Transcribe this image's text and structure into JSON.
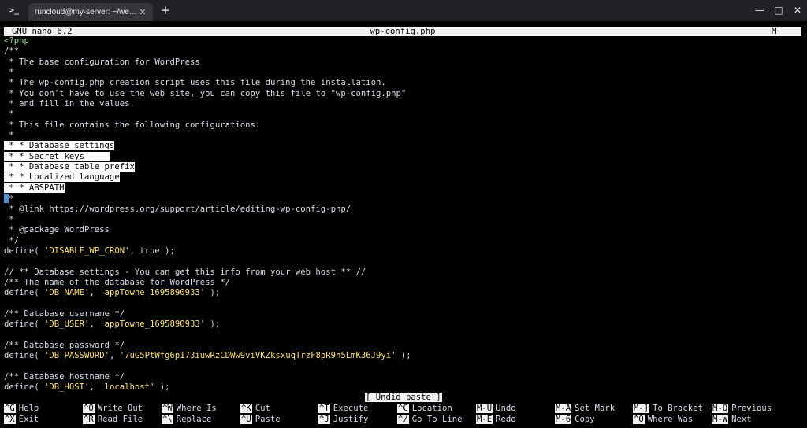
{
  "window": {
    "tab_title": "runcloud@my-server: ~/webapps/a",
    "app_icon": ">_",
    "new_tab": "+",
    "controls": {
      "minimize": "—",
      "maximize": "□",
      "close": "✕"
    }
  },
  "nano": {
    "version": "GNU nano 6.2",
    "filename": "wp-config.php",
    "modified_flag": "M",
    "status_message": "[ Undid paste ]"
  },
  "code": [
    [
      {
        "t": "kw",
        "v": "<?php"
      }
    ],
    [
      {
        "t": "c",
        "v": "/**"
      }
    ],
    [
      {
        "t": "c",
        "v": " * The base configuration for WordPress"
      }
    ],
    [
      {
        "t": "c",
        "v": " *"
      }
    ],
    [
      {
        "t": "c",
        "v": " * The wp-config.php creation script uses this file during the installation."
      }
    ],
    [
      {
        "t": "c",
        "v": " * You don't have to use the web site, you can copy this file to \"wp-config.php\""
      }
    ],
    [
      {
        "t": "c",
        "v": " * and fill in the values."
      }
    ],
    [
      {
        "t": "c",
        "v": " *"
      }
    ],
    [
      {
        "t": "c",
        "v": " * This file contains the following configurations:"
      }
    ],
    [
      {
        "t": "c",
        "v": " *"
      }
    ],
    [
      {
        "t": "sel",
        "v": " * * Database settings"
      }
    ],
    [
      {
        "t": "sel",
        "v": " * * Secret keys"
      },
      {
        "t": "pad",
        "v": "     "
      }
    ],
    [
      {
        "t": "sel",
        "v": " * * Database table prefix"
      }
    ],
    [
      {
        "t": "sel",
        "v": " * * Localized language"
      }
    ],
    [
      {
        "t": "sel",
        "v": " * * ABSPATH"
      }
    ],
    [
      {
        "t": "cursor",
        "v": ""
      },
      {
        "t": "c",
        "v": "*"
      }
    ],
    [
      {
        "t": "c",
        "v": " * @link https://wordpress.org/support/article/editing-wp-config-php/"
      }
    ],
    [
      {
        "t": "c",
        "v": " *"
      }
    ],
    [
      {
        "t": "c",
        "v": " * @package WordPress"
      }
    ],
    [
      {
        "t": "c",
        "v": " */"
      }
    ],
    [
      {
        "t": "c",
        "v": "define( "
      },
      {
        "t": "str",
        "v": "'DISABLE_WP_CRON'"
      },
      {
        "t": "c",
        "v": ", true );"
      }
    ],
    [
      {
        "t": "c",
        "v": ""
      }
    ],
    [
      {
        "t": "c",
        "v": "// ** Database settings - You can get this info from your web host ** //"
      }
    ],
    [
      {
        "t": "c",
        "v": "/** The name of the database for WordPress */"
      }
    ],
    [
      {
        "t": "c",
        "v": "define( "
      },
      {
        "t": "str",
        "v": "'DB_NAME'"
      },
      {
        "t": "c",
        "v": ", "
      },
      {
        "t": "str",
        "v": "'appTowne_1695890933'"
      },
      {
        "t": "c",
        "v": " );"
      }
    ],
    [
      {
        "t": "c",
        "v": ""
      }
    ],
    [
      {
        "t": "c",
        "v": "/** Database username */"
      }
    ],
    [
      {
        "t": "c",
        "v": "define( "
      },
      {
        "t": "str",
        "v": "'DB_USER'"
      },
      {
        "t": "c",
        "v": ", "
      },
      {
        "t": "str",
        "v": "'appTowne_1695890933'"
      },
      {
        "t": "c",
        "v": " );"
      }
    ],
    [
      {
        "t": "c",
        "v": ""
      }
    ],
    [
      {
        "t": "c",
        "v": "/** Database password */"
      }
    ],
    [
      {
        "t": "c",
        "v": "define( "
      },
      {
        "t": "str",
        "v": "'DB_PASSWORD'"
      },
      {
        "t": "c",
        "v": ", "
      },
      {
        "t": "str",
        "v": "'7uG5PtWfg6p173iuwRzCDWw9viVKZksxuqTrzF8pR9h5LmK36J9yi'"
      },
      {
        "t": "c",
        "v": " );"
      }
    ],
    [
      {
        "t": "c",
        "v": ""
      }
    ],
    [
      {
        "t": "c",
        "v": "/** Database hostname */"
      }
    ],
    [
      {
        "t": "c",
        "v": "define( "
      },
      {
        "t": "str",
        "v": "'DB_HOST'"
      },
      {
        "t": "c",
        "v": ", "
      },
      {
        "t": "str",
        "v": "'localhost'"
      },
      {
        "t": "c",
        "v": " );"
      }
    ]
  ],
  "shortcuts": [
    {
      "key": "^G",
      "label": "Help"
    },
    {
      "key": "^X",
      "label": "Exit"
    },
    {
      "key": "^O",
      "label": "Write Out"
    },
    {
      "key": "^R",
      "label": "Read File"
    },
    {
      "key": "^W",
      "label": "Where Is"
    },
    {
      "key": "^\\",
      "label": "Replace"
    },
    {
      "key": "^K",
      "label": "Cut"
    },
    {
      "key": "^U",
      "label": "Paste"
    },
    {
      "key": "^T",
      "label": "Execute"
    },
    {
      "key": "^J",
      "label": "Justify"
    },
    {
      "key": "^C",
      "label": "Location"
    },
    {
      "key": "^/",
      "label": "Go To Line"
    },
    {
      "key": "M-U",
      "label": "Undo"
    },
    {
      "key": "M-E",
      "label": "Redo"
    },
    {
      "key": "M-A",
      "label": "Set Mark"
    },
    {
      "key": "M-6",
      "label": "Copy"
    },
    {
      "key": "M-]",
      "label": "To Bracket"
    },
    {
      "key": "^Q",
      "label": "Where Was"
    },
    {
      "key": "M-Q",
      "label": "Previous"
    },
    {
      "key": "M-W",
      "label": "Next"
    }
  ],
  "colors": {
    "keyword": "#9be39b",
    "string": "#ffe16a",
    "text": "#d8dce8",
    "cursor": "#4d8fd8",
    "bar": "#f2f2f2"
  }
}
